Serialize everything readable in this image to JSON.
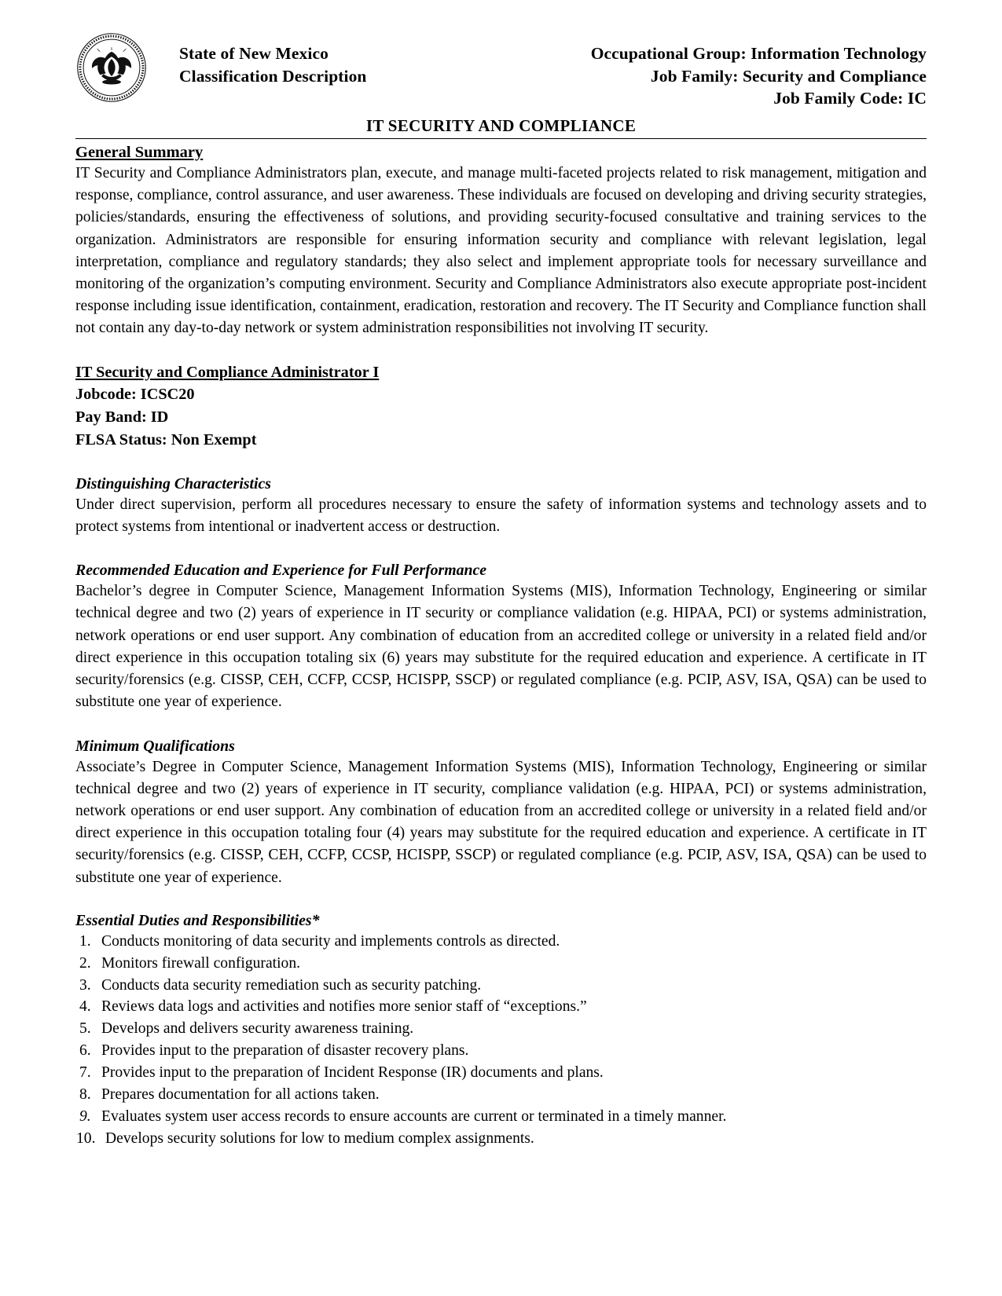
{
  "header": {
    "seal_alt": "state-seal-of-new-mexico",
    "left_line1": "State of New Mexico",
    "left_line2": "Classification Description",
    "right_line1": "Occupational Group: Information Technology",
    "right_line2": "Job Family: Security and Compliance",
    "right_line3": "Job Family Code: IC"
  },
  "title": "IT SECURITY AND COMPLIANCE",
  "general_summary": {
    "heading": "General Summary",
    "text": "IT Security and Compliance Administrators plan, execute, and manage multi-faceted projects related to risk management, mitigation and response, compliance, control assurance, and user awareness.  These individuals are focused on developing and driving security strategies, policies/standards, ensuring the effectiveness of solutions, and providing security-focused consultative and training services to the organization. Administrators are responsible for ensuring information security and compliance with relevant legislation, legal interpretation, compliance and regulatory standards; they also select and implement appropriate tools for necessary surveillance and monitoring of the organization’s computing environment. Security and Compliance Administrators also execute appropriate post-incident response including issue identification, containment, eradication, restoration and recovery.  The IT Security and Compliance function shall not contain any day-to-day network or system administration responsibilities not involving IT security."
  },
  "job": {
    "title": "IT Security and Compliance Administrator I",
    "jobcode_label": "Jobcode: ICSC20",
    "payband_label": "Pay Band: ID",
    "flsa_label": "FLSA Status: Non Exempt"
  },
  "sections": [
    {
      "heading": "Distinguishing Characteristics",
      "text": "Under direct supervision, perform all procedures necessary to ensure the safety of information systems and technology assets and to protect systems from intentional or inadvertent access or destruction."
    },
    {
      "heading": "Recommended Education and Experience for Full Performance",
      "text": "Bachelor’s degree in Computer Science, Management Information Systems (MIS), Information Technology, Engineering or similar technical degree and two (2) years of experience in IT security or compliance validation (e.g. HIPAA, PCI) or systems administration, network operations or end user support. Any combination of education from an accredited college or university in a related field and/or direct experience in this occupation totaling six (6) years may substitute for the required education and experience. A certificate in IT security/forensics (e.g. CISSP, CEH, CCFP, CCSP, HCISPP, SSCP) or regulated compliance (e.g. PCIP, ASV, ISA, QSA) can be used to substitute one year of experience."
    },
    {
      "heading": "Minimum Qualifications",
      "text": "Associate’s Degree in Computer Science, Management Information Systems (MIS), Information Technology, Engineering or similar technical degree and two (2) years of experience in IT security, compliance validation (e.g. HIPAA, PCI) or systems administration, network operations or end user support. Any combination of education from an accredited college or university in a related field and/or direct experience in this occupation totaling four (4) years may substitute for the required education and experience. A certificate in IT security/forensics (e.g. CISSP, CEH, CCFP, CCSP, HCISPP, SSCP) or regulated compliance (e.g. PCIP, ASV, ISA, QSA) can be used to substitute one year of experience."
    }
  ],
  "duties": {
    "heading": "Essential Duties and Responsibilities*",
    "items": [
      {
        "num": "1.",
        "text": "Conducts monitoring of data security and implements controls as directed."
      },
      {
        "num": "2.",
        "text": "Monitors firewall configuration."
      },
      {
        "num": "3.",
        "text": "Conducts data security remediation such as security patching."
      },
      {
        "num": "4.",
        "text": "Reviews data logs and activities and notifies more senior staff of “exceptions.”"
      },
      {
        "num": "5.",
        "text": "Develops and delivers security awareness training."
      },
      {
        "num": "6.",
        "text": "Provides input to the preparation of disaster recovery plans."
      },
      {
        "num": "7.",
        "text": "Provides input to the preparation of Incident Response (IR) documents and plans."
      },
      {
        "num": "8.",
        "text": "Prepares documentation for all actions taken."
      },
      {
        "num": "9.",
        "text": "Evaluates system user access records to ensure accounts are current or terminated in a timely manner."
      },
      {
        "num": "10.",
        "text": "Develops security solutions for low to medium complex assignments."
      }
    ]
  }
}
